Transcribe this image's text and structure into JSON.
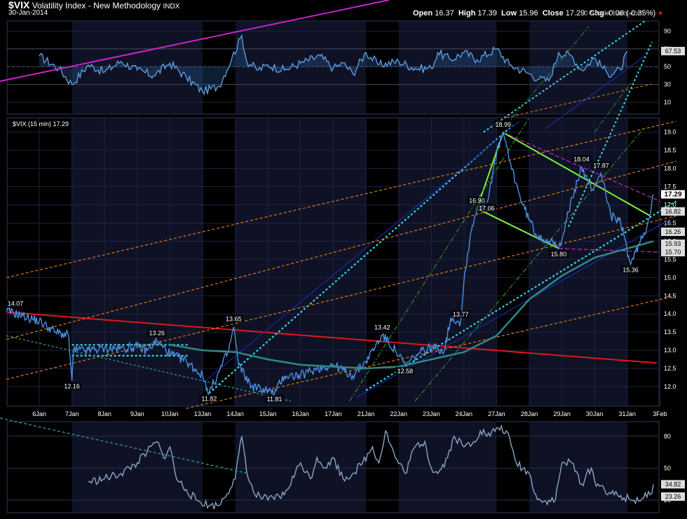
{
  "header": {
    "symbol": "$VIX",
    "name": "Volatility Index - New Methodology",
    "exchange": "INDX",
    "date": "30-Jan-2014",
    "open_label": "Open",
    "open": "16.37",
    "high_label": "High",
    "high": "17.39",
    "low_label": "Low",
    "low": "15.96",
    "close_label": "Close",
    "close": "17.29",
    "chg_label": "Chg",
    "chg": "-0.06 (-0.35%)",
    "watermark": "© StockCharts.com"
  },
  "colors": {
    "background": "#000000",
    "panel_bg": "#0f1225",
    "shade": "#1a1c36",
    "price": "#4a90e0",
    "rsi": "#5ea2e6",
    "osc": "#8aa6c9",
    "ma": "#2e8a86",
    "red_line": "#e01818",
    "magenta": "#cc22cc",
    "cyan": "#36d6e6",
    "green": "#7cf03a",
    "orange": "#e07a14",
    "navy": "#1a2aa8"
  },
  "chart_data": [
    {
      "type": "line",
      "panel": "rsi",
      "y_ticks": [
        10,
        30,
        50,
        70,
        90
      ],
      "current_label": "67.53",
      "current_value": 67.53,
      "x": [
        "6Jan",
        "7Jan",
        "8Jan",
        "9Jan",
        "10Jan",
        "13Jan",
        "14Jan",
        "15Jan",
        "16Jan",
        "17Jan",
        "21Jan",
        "22Jan",
        "23Jan",
        "24Jan",
        "27Jan",
        "28Jan",
        "29Jan",
        "30Jan",
        "31Jan"
      ],
      "keypoints": [
        [
          0.0,
          62
        ],
        [
          0.6,
          48
        ],
        [
          1.0,
          30
        ],
        [
          1.5,
          52
        ],
        [
          2.0,
          44
        ],
        [
          2.5,
          56
        ],
        [
          3.0,
          46
        ],
        [
          3.5,
          40
        ],
        [
          4.0,
          54
        ],
        [
          4.5,
          38
        ],
        [
          5.0,
          22
        ],
        [
          5.5,
          28
        ],
        [
          5.9,
          60
        ],
        [
          6.2,
          85
        ],
        [
          6.35,
          56
        ],
        [
          6.7,
          46
        ],
        [
          7.0,
          52
        ],
        [
          7.5,
          46
        ],
        [
          8.0,
          54
        ],
        [
          8.6,
          62
        ],
        [
          9.0,
          48
        ],
        [
          9.3,
          54
        ],
        [
          9.6,
          42
        ],
        [
          10.0,
          66
        ],
        [
          10.4,
          52
        ],
        [
          11.0,
          56
        ],
        [
          11.5,
          48
        ],
        [
          12.0,
          48
        ],
        [
          12.2,
          66
        ],
        [
          12.6,
          58
        ],
        [
          13.0,
          66
        ],
        [
          13.4,
          58
        ],
        [
          14.0,
          70
        ],
        [
          14.4,
          52
        ],
        [
          15.0,
          42
        ],
        [
          15.3,
          36
        ],
        [
          15.6,
          34
        ],
        [
          15.9,
          66
        ],
        [
          16.3,
          62
        ],
        [
          16.6,
          46
        ],
        [
          17.0,
          60
        ],
        [
          17.4,
          42
        ],
        [
          17.8,
          46
        ],
        [
          18.0,
          67.5
        ]
      ]
    },
    {
      "type": "line",
      "title": "$VIX (15 min) 17.29",
      "y_ticks": [
        12.0,
        12.5,
        13.0,
        13.5,
        14.0,
        14.5,
        15.0,
        15.5,
        16.0,
        16.5,
        17.0,
        17.5,
        18.0,
        18.5,
        19.0
      ],
      "x_labels": [
        "6Jan",
        "7Jan",
        "8Jan",
        "9Jan",
        "10Jan",
        "13Jan",
        "14Jan",
        "15Jan",
        "16Jan",
        "17Jan",
        "21Jan",
        "22Jan",
        "23Jan",
        "24Jan",
        "27Jan",
        "28Jan",
        "29Jan",
        "30Jan",
        "31Jan",
        "3Feb"
      ],
      "close_keypoints": [
        [
          -1.0,
          14.07
        ],
        [
          -0.5,
          13.95
        ],
        [
          0.0,
          13.8
        ],
        [
          0.5,
          13.5
        ],
        [
          0.9,
          13.4
        ],
        [
          1.0,
          12.16
        ],
        [
          1.05,
          13.0
        ],
        [
          1.5,
          13.0
        ],
        [
          2.0,
          13.05
        ],
        [
          2.5,
          13.05
        ],
        [
          3.0,
          13.1
        ],
        [
          3.3,
          13.0
        ],
        [
          3.6,
          13.26
        ],
        [
          4.0,
          12.9
        ],
        [
          4.5,
          12.7
        ],
        [
          5.0,
          12.3
        ],
        [
          5.2,
          11.82
        ],
        [
          5.5,
          12.4
        ],
        [
          5.8,
          13.0
        ],
        [
          5.95,
          13.65
        ],
        [
          6.1,
          12.6
        ],
        [
          6.5,
          12.0
        ],
        [
          7.0,
          11.9
        ],
        [
          7.2,
          11.81
        ],
        [
          7.5,
          12.3
        ],
        [
          8.0,
          12.3
        ],
        [
          8.5,
          12.5
        ],
        [
          9.0,
          12.6
        ],
        [
          9.4,
          12.4
        ],
        [
          9.6,
          12.3
        ],
        [
          10.0,
          12.7
        ],
        [
          10.5,
          13.42
        ],
        [
          10.9,
          13.0
        ],
        [
          11.2,
          12.58
        ],
        [
          11.6,
          12.9
        ],
        [
          12.0,
          13.1
        ],
        [
          12.4,
          13.0
        ],
        [
          12.6,
          13.9
        ],
        [
          12.9,
          13.77
        ],
        [
          13.0,
          14.9
        ],
        [
          13.2,
          16.2
        ],
        [
          13.4,
          16.9
        ],
        [
          13.7,
          17.06
        ],
        [
          14.0,
          18.4
        ],
        [
          14.2,
          18.99
        ],
        [
          14.4,
          18.2
        ],
        [
          14.8,
          17.0
        ],
        [
          15.2,
          16.2
        ],
        [
          15.6,
          16.0
        ],
        [
          15.9,
          15.8
        ],
        [
          16.2,
          16.8
        ],
        [
          16.6,
          18.04
        ],
        [
          16.9,
          17.4
        ],
        [
          17.2,
          17.87
        ],
        [
          17.5,
          16.7
        ],
        [
          17.8,
          16.5
        ],
        [
          18.1,
          15.36
        ],
        [
          18.4,
          16.0
        ],
        [
          18.6,
          16.4
        ],
        [
          18.8,
          17.29
        ]
      ],
      "series_labels": [
        {
          "x": -1.0,
          "y": 14.07,
          "text": "14.07"
        },
        {
          "x": 1.0,
          "y": 12.16,
          "text": "12.16"
        },
        {
          "x": 3.6,
          "y": 13.26,
          "text": "13.26"
        },
        {
          "x": 5.2,
          "y": 11.82,
          "text": "11.82"
        },
        {
          "x": 5.95,
          "y": 13.65,
          "text": "13.65"
        },
        {
          "x": 7.2,
          "y": 11.81,
          "text": "11.81"
        },
        {
          "x": 10.5,
          "y": 13.42,
          "text": "13.42"
        },
        {
          "x": 11.2,
          "y": 12.58,
          "text": "12.58"
        },
        {
          "x": 12.9,
          "y": 13.77,
          "text": "13.77"
        },
        {
          "x": 13.4,
          "y": 16.9,
          "text": "16.90"
        },
        {
          "x": 13.7,
          "y": 17.06,
          "text": "17.06"
        },
        {
          "x": 14.2,
          "y": 18.99,
          "text": "18.99"
        },
        {
          "x": 15.9,
          "y": 15.8,
          "text": "15.80"
        },
        {
          "x": 16.6,
          "y": 18.04,
          "text": "18.04"
        },
        {
          "x": 17.2,
          "y": 17.87,
          "text": "17.87"
        },
        {
          "x": 18.1,
          "y": 15.36,
          "text": "15.36"
        }
      ],
      "right_labels": [
        {
          "value": 17.29,
          "text": "17.29",
          "bold": true
        },
        {
          "value": 16.82,
          "text": "16.82"
        },
        {
          "value": 16.26,
          "text": "16.26"
        },
        {
          "value": 15.93,
          "text": "15.93"
        },
        {
          "value": 15.7,
          "text": "15.70"
        }
      ],
      "moving_average": [
        [
          4.0,
          13.15
        ],
        [
          5.0,
          13.0
        ],
        [
          6.0,
          12.95
        ],
        [
          7.0,
          12.75
        ],
        [
          8.0,
          12.6
        ],
        [
          9.0,
          12.55
        ],
        [
          10.0,
          12.5
        ],
        [
          11.0,
          12.55
        ],
        [
          12.0,
          12.75
        ],
        [
          13.0,
          12.95
        ],
        [
          14.0,
          13.4
        ],
        [
          15.0,
          14.4
        ],
        [
          16.0,
          15.05
        ],
        [
          17.0,
          15.55
        ],
        [
          18.0,
          15.8
        ],
        [
          18.8,
          16.0
        ]
      ],
      "trendlines": [
        {
          "color": "red",
          "from": [
            -1.0,
            14.05
          ],
          "to": [
            18.9,
            12.65
          ]
        },
        {
          "color": "magenta",
          "from": [
            14.2,
            18.99
          ],
          "to": [
            19.0,
            17.1
          ]
        },
        {
          "color": "magenta",
          "from": [
            15.9,
            15.8
          ],
          "to": [
            19.0,
            15.7
          ]
        },
        {
          "color": "green",
          "from": [
            13.4,
            16.9
          ],
          "to": [
            14.2,
            18.99
          ]
        },
        {
          "color": "green",
          "from": [
            13.4,
            16.9
          ],
          "to": [
            15.9,
            15.8
          ]
        },
        {
          "color": "green",
          "from": [
            14.2,
            18.99
          ],
          "to": [
            18.7,
            16.7
          ]
        },
        {
          "color": "cyan",
          "from": [
            5.2,
            11.82
          ],
          "to": [
            14.5,
            19.2
          ]
        },
        {
          "color": "cyan",
          "from": [
            10.0,
            11.9
          ],
          "to": [
            19.5,
            17.1
          ]
        },
        {
          "color": "cyan",
          "from": [
            1.0,
            13.15
          ],
          "to": [
            4.6,
            13.15
          ]
        },
        {
          "color": "cyan",
          "from": [
            1.0,
            12.85
          ],
          "to": [
            4.6,
            12.85
          ]
        },
        {
          "color": "navy",
          "from": [
            5.0,
            12.1
          ],
          "to": [
            14.7,
            19.3
          ]
        },
        {
          "color": "navy",
          "from": [
            9.7,
            11.7
          ],
          "to": [
            19.5,
            16.7
          ]
        },
        {
          "color": "orange",
          "from": [
            -1.0,
            15.0
          ],
          "to": [
            19.5,
            19.3
          ]
        },
        {
          "color": "orange",
          "from": [
            -1.0,
            13.3
          ],
          "to": [
            19.5,
            18.2
          ]
        },
        {
          "color": "orange",
          "from": [
            -1.0,
            12.2
          ],
          "to": [
            19.5,
            16.7
          ]
        },
        {
          "color": "orange",
          "from": [
            4.5,
            11.4
          ],
          "to": [
            19.5,
            14.5
          ]
        },
        {
          "color": "green",
          "dash": "dot",
          "from": [
            9.5,
            11.6
          ],
          "to": [
            15.0,
            19.4
          ]
        },
        {
          "color": "green",
          "dash": "dot",
          "from": [
            11.5,
            11.6
          ],
          "to": [
            18.5,
            19.1
          ]
        }
      ]
    },
    {
      "type": "line",
      "panel": "oscillator",
      "y_ticks": [
        20,
        50,
        80
      ],
      "current_labels": [
        "34.82",
        "23.26"
      ],
      "keypoints": [
        [
          1.5,
          37
        ],
        [
          2.0,
          40
        ],
        [
          2.5,
          45
        ],
        [
          3.0,
          55
        ],
        [
          3.3,
          65
        ],
        [
          3.6,
          75
        ],
        [
          3.8,
          60
        ],
        [
          4.0,
          70
        ],
        [
          4.2,
          40
        ],
        [
          4.5,
          30
        ],
        [
          4.8,
          20
        ],
        [
          5.2,
          15
        ],
        [
          5.5,
          15
        ],
        [
          6.0,
          40
        ],
        [
          6.2,
          80
        ],
        [
          6.4,
          40
        ],
        [
          6.6,
          25
        ],
        [
          7.0,
          20
        ],
        [
          7.5,
          25
        ],
        [
          8.0,
          55
        ],
        [
          8.3,
          40
        ],
        [
          8.5,
          60
        ],
        [
          8.8,
          50
        ],
        [
          9.0,
          60
        ],
        [
          9.3,
          40
        ],
        [
          9.6,
          45
        ],
        [
          9.9,
          55
        ],
        [
          10.2,
          70
        ],
        [
          10.4,
          55
        ],
        [
          10.6,
          85
        ],
        [
          10.9,
          60
        ],
        [
          11.2,
          45
        ],
        [
          11.5,
          70
        ],
        [
          11.8,
          75
        ],
        [
          12.0,
          50
        ],
        [
          12.2,
          45
        ],
        [
          12.5,
          60
        ],
        [
          12.7,
          80
        ],
        [
          13.0,
          70
        ],
        [
          13.3,
          75
        ],
        [
          13.5,
          85
        ],
        [
          13.8,
          80
        ],
        [
          14.0,
          88
        ],
        [
          14.3,
          85
        ],
        [
          14.6,
          55
        ],
        [
          15.0,
          45
        ],
        [
          15.2,
          25
        ],
        [
          15.4,
          18
        ],
        [
          15.6,
          20
        ],
        [
          15.8,
          20
        ],
        [
          16.0,
          55
        ],
        [
          16.3,
          55
        ],
        [
          16.6,
          35
        ],
        [
          16.9,
          50
        ],
        [
          17.0,
          38
        ],
        [
          17.3,
          30
        ],
        [
          17.6,
          25
        ],
        [
          17.9,
          22
        ],
        [
          18.2,
          20
        ],
        [
          18.5,
          22
        ],
        [
          18.7,
          25
        ],
        [
          18.8,
          34.82
        ]
      ],
      "trendline": {
        "from": [
          -1.0,
          97
        ],
        "to": [
          6.4,
          45
        ]
      }
    }
  ]
}
